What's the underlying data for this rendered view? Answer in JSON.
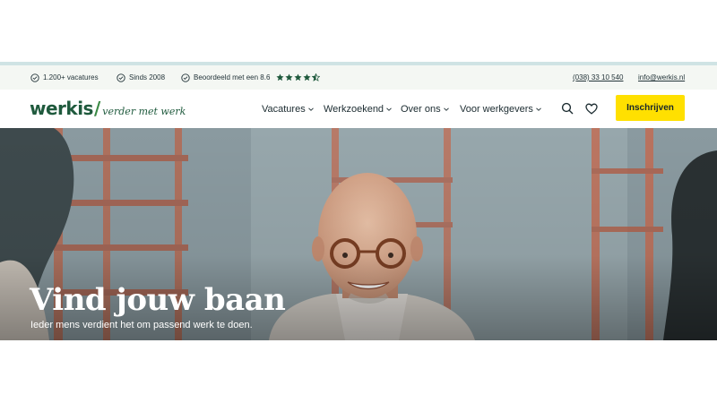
{
  "topbar": {
    "usps": [
      "1.200+ vacatures",
      "Sinds 2008",
      "Beoordeeld met een 8.6"
    ],
    "rating_stars": 4.5,
    "phone": "(038) 33 10 540",
    "email": "info@werkis.nl"
  },
  "logo": {
    "word": "werkis",
    "slash": "/",
    "tagline": "verder met werk"
  },
  "nav": {
    "items": [
      "Vacatures",
      "Werkzoekend",
      "Over ons",
      "Voor werkgevers"
    ]
  },
  "header": {
    "cta_label": "Inschrijven"
  },
  "hero": {
    "title": "Vind jouw baan",
    "subtitle": "Ieder mens verdient het om passend werk te doen."
  },
  "colors": {
    "brand_green": "#1f5a3d",
    "accent_green": "#3b8a45",
    "cta_yellow": "#ffe000",
    "topbar_bg": "#f4f7f3"
  },
  "icons": [
    "check-circle-icon",
    "star-icon",
    "chevron-down-icon",
    "search-icon",
    "heart-icon"
  ]
}
